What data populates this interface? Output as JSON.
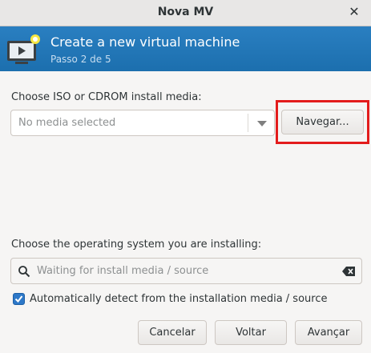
{
  "window": {
    "title": "Nova MV",
    "close_icon": "close-icon"
  },
  "banner": {
    "heading": "Create a new virtual machine",
    "step": "Passo 2 de 5",
    "icon": "virtual-machine-icon",
    "color": "#1f77b4"
  },
  "install_media": {
    "label": "Choose ISO or CDROM install media:",
    "selected_value": "No media selected",
    "browse_label": "Navegar...",
    "highlight_color": "#e31c1c"
  },
  "os": {
    "label": "Choose the operating system you are installing:",
    "search_placeholder": "Waiting for install media / source",
    "auto_detect_label": "Automatically detect from the installation media / source",
    "auto_detect_checked": true
  },
  "footer": {
    "cancel_label": "Cancelar",
    "back_label": "Voltar",
    "forward_label": "Avançar"
  }
}
